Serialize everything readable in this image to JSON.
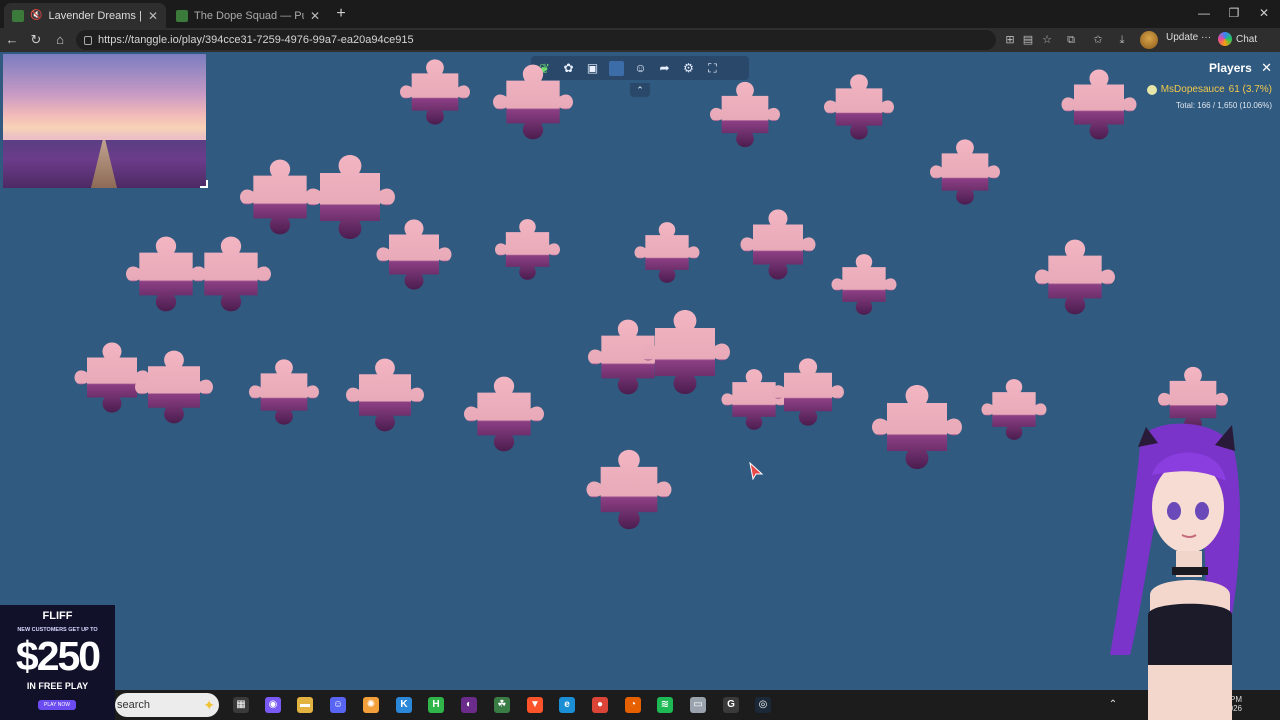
{
  "browser": {
    "tabs": [
      {
        "title": "Lavender Dreams | Sky Jig",
        "active": true
      },
      {
        "title": "The Dope Squad — Puzzles",
        "active": false
      }
    ],
    "url": "https://tanggle.io/play/394cce31-7259-4976-99a7-ea20a94ce915",
    "update_label": "Update",
    "chat_label": "Chat"
  },
  "puzzle": {
    "toolbar_icons": [
      "tanggle-logo-icon",
      "puzzle-piece-icon",
      "image-icon",
      "background-color-icon",
      "players-icon",
      "share-icon",
      "settings-icon",
      "fullscreen-icon"
    ],
    "players": {
      "title": "Players",
      "player_name": "MsDopesauce",
      "player_score": "61 (3.7%)",
      "total": "Total: 166 / 1,650 (10.06%)"
    },
    "board_color": "#305a7f"
  },
  "ad": {
    "brand": "FLIFF",
    "tag": "NEW CUSTOMERS GET UP TO",
    "amount": "$250",
    "sub": "IN FREE PLAY",
    "cta": "PLAY NOW"
  },
  "taskbar": {
    "search_placeholder": "search",
    "time": "8:36 PM",
    "date": "/2026"
  }
}
